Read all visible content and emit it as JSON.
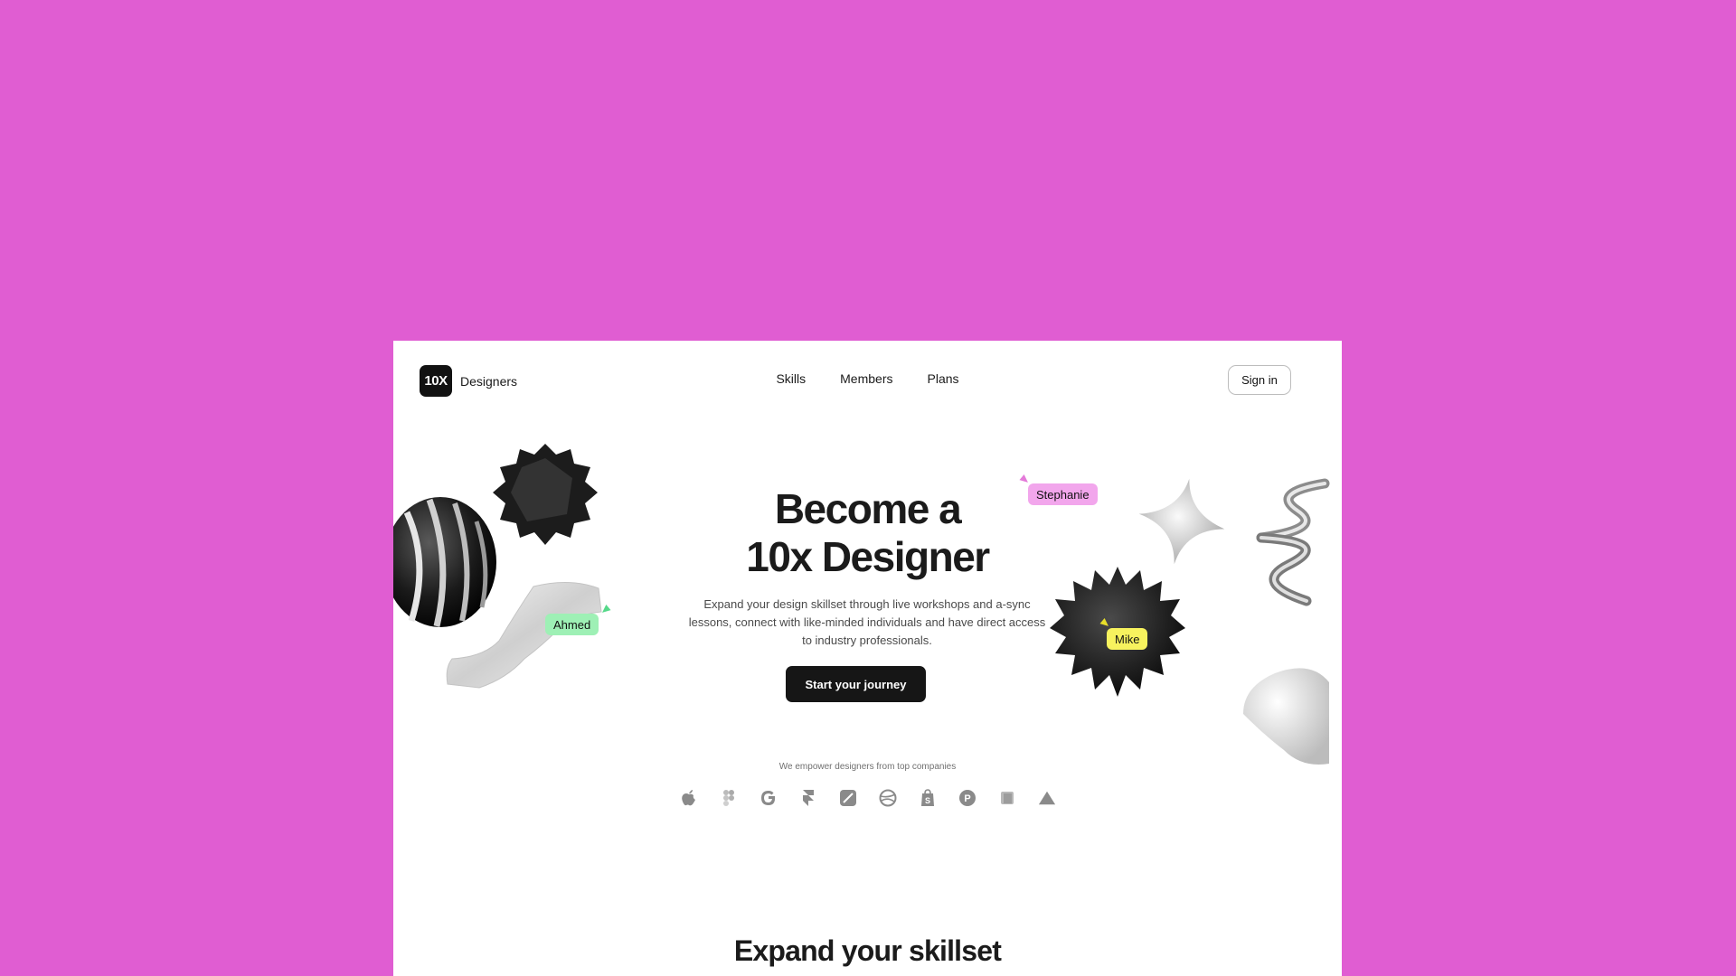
{
  "brand": {
    "mark": "10X",
    "name": "Designers"
  },
  "nav": {
    "items": [
      "Skills",
      "Members",
      "Plans"
    ]
  },
  "header": {
    "signin_label": "Sign in"
  },
  "hero": {
    "title_line1": "Become a",
    "title_line2": "10x Designer",
    "subtitle": "Expand your design skillset through live workshops and a-sync lessons, connect with like-minded individuals and have direct access to industry professionals.",
    "cta_label": "Start your journey"
  },
  "badges": {
    "stephanie": "Stephanie",
    "ahmed": "Ahmed",
    "mike": "Mike"
  },
  "companies": {
    "caption": "We empower designers from top companies",
    "logos": [
      "apple-icon",
      "figma-icon",
      "google-icon",
      "framer-icon",
      "linear-icon",
      "dribbble-icon",
      "shopify-icon",
      "producthunt-icon",
      "notion-icon",
      "vercel-icon"
    ]
  },
  "section": {
    "title": "Expand your skillset"
  },
  "colors": {
    "background": "#e05dd2",
    "page": "#ffffff",
    "dark": "#161616",
    "badge_stephanie": "#f2a6ec",
    "badge_ahmed": "#9ef0b5",
    "badge_mike": "#f7f25e"
  }
}
